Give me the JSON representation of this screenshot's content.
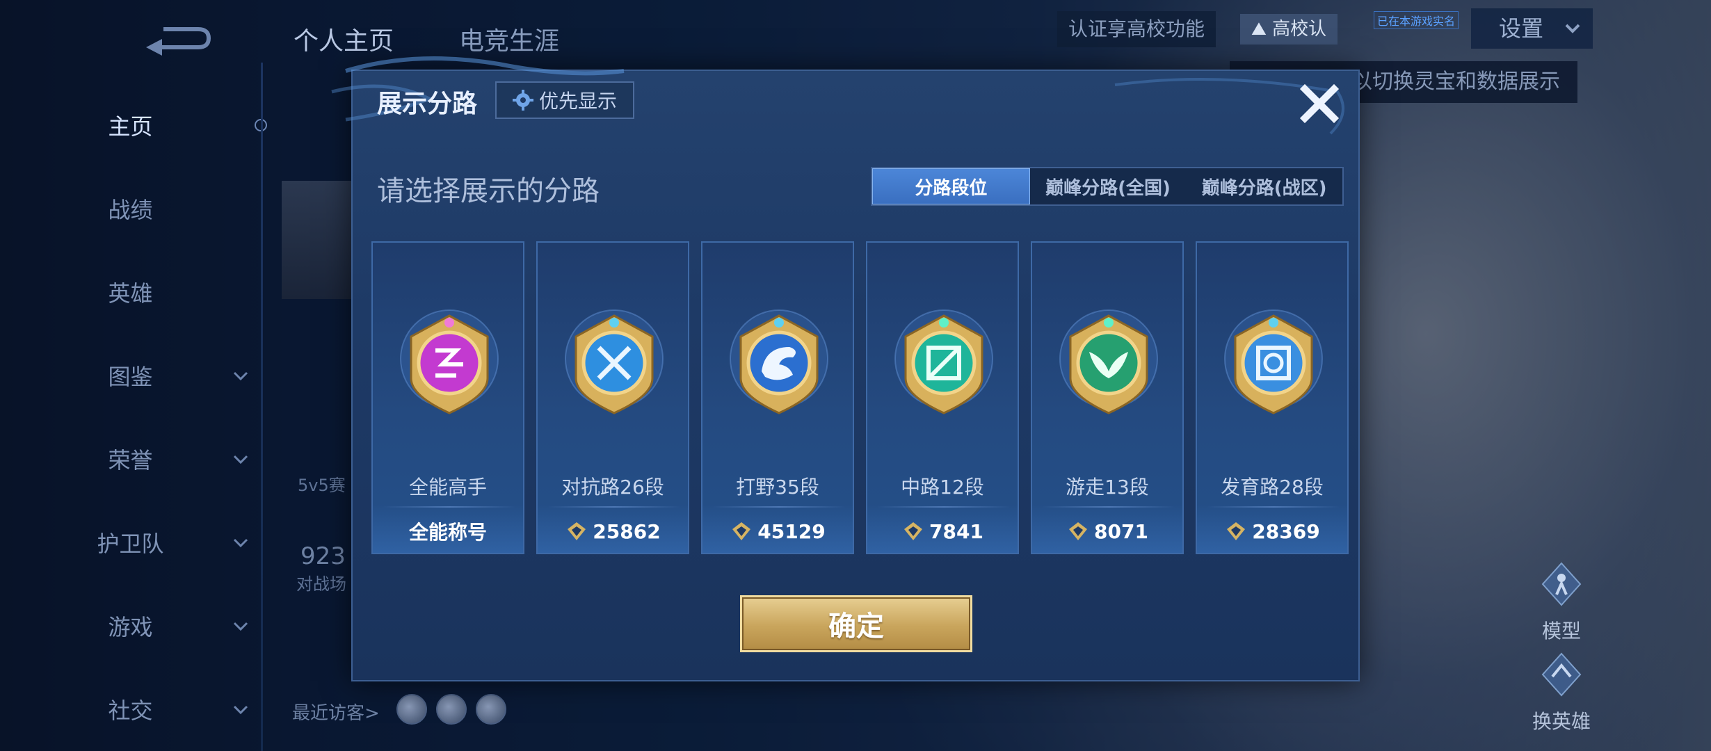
{
  "nav": {
    "items": [
      {
        "label": "主页",
        "active": true,
        "chevron": false
      },
      {
        "label": "战绩",
        "active": false,
        "chevron": false
      },
      {
        "label": "英雄",
        "active": false,
        "chevron": false
      },
      {
        "label": "图鉴",
        "active": false,
        "chevron": true
      },
      {
        "label": "荣誉",
        "active": false,
        "chevron": true
      },
      {
        "label": "护卫队",
        "active": false,
        "chevron": true
      },
      {
        "label": "游戏",
        "active": false,
        "chevron": true
      },
      {
        "label": "社交",
        "active": false,
        "chevron": true
      }
    ]
  },
  "top_tabs": [
    "个人主页",
    "电竞生涯"
  ],
  "top_right": {
    "cert_text": "认证享高校功能",
    "school_badge": "高校认",
    "tag": "已在本游戏实名",
    "settings": "设置",
    "tooltip": "以切换灵宝和数据展示"
  },
  "background": {
    "rank_mode": "5v5赛",
    "number": "923",
    "number_sub": "对战场",
    "visitors": "最近访客>",
    "side_model": "模型",
    "side_switch": "换英雄"
  },
  "modal": {
    "title": "展示分路",
    "priority_button": "优先显示",
    "prompt": "请选择展示的分路",
    "segments": [
      {
        "label": "分路段位",
        "active": true
      },
      {
        "label": "巅峰分路(全国)",
        "active": false
      },
      {
        "label": "巅峰分路(战区)",
        "active": false
      }
    ],
    "lanes": [
      {
        "name": "全能高手",
        "value": "全能称号",
        "show_points_icon": false,
        "badge_color": "#c33ad0",
        "badge_icon": "all-rounder-icon"
      },
      {
        "name": "对抗路26段",
        "value": "25862",
        "show_points_icon": true,
        "badge_color": "#2e8fe0",
        "badge_icon": "clash-lane-icon"
      },
      {
        "name": "打野35段",
        "value": "45129",
        "show_points_icon": true,
        "badge_color": "#2b6fd0",
        "badge_icon": "jungle-dragon-icon"
      },
      {
        "name": "中路12段",
        "value": "7841",
        "show_points_icon": true,
        "badge_color": "#1fb59a",
        "badge_icon": "mid-lane-icon"
      },
      {
        "name": "游走13段",
        "value": "8071",
        "show_points_icon": true,
        "badge_color": "#26a070",
        "badge_icon": "roam-wings-icon"
      },
      {
        "name": "发育路28段",
        "value": "28369",
        "show_points_icon": true,
        "badge_color": "#3a8fe0",
        "badge_icon": "farm-lane-icon"
      }
    ],
    "confirm": "确定"
  },
  "colors": {
    "accent": "#3a6fc0",
    "gold": "#c9a55c",
    "modal_bg": "#1e3a66"
  }
}
